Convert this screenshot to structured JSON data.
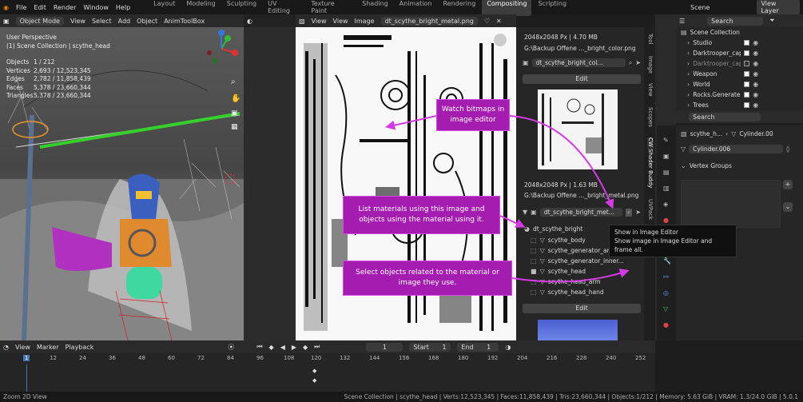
{
  "topbar": {
    "menus": [
      "File",
      "Edit",
      "Render",
      "Window",
      "Help"
    ],
    "workspaces": [
      "Layout",
      "Modeling",
      "Sculpting",
      "UV Editing",
      "Texture Paint",
      "Shading",
      "Animation",
      "Rendering",
      "Compositing",
      "Scripting"
    ],
    "active": "Compositing",
    "scene": "Scene",
    "view_layer": "View Layer"
  },
  "viewport": {
    "mode": "Object Mode",
    "menu": [
      "View",
      "Select",
      "Add",
      "Object",
      "AnimToolBox"
    ],
    "perspective": "User Perspective",
    "collection": "(1) Scene Collection | scythe_head",
    "stats": [
      {
        "k": "Objects",
        "v": "1 / 212"
      },
      {
        "k": "Vertices",
        "v": "2,693 / 12,523,345"
      },
      {
        "k": "Edges",
        "v": "2,782 / 11,858,439"
      },
      {
        "k": "Faces",
        "v": "5,378 / 23,660,344"
      },
      {
        "k": "Triangles",
        "v": "5,378 / 23,660,344"
      }
    ]
  },
  "image_editor": {
    "menu": [
      "View",
      "View",
      "Image"
    ],
    "filename": "dt_scythe_bright_metal.png"
  },
  "sidebar": {
    "img1": {
      "size": "2048x2048 Px | 4.70 MB",
      "path": "G:\\Backup Offene ..._bright_color.png",
      "name": "dt_scythe_bright_col...",
      "edit": "Edit"
    },
    "img2": {
      "size": "2048x2048 Px | 1.63 MB",
      "path": "G:\\Backup Offene ..._bright_metal.png",
      "name": "dt_scythe_bright_met...",
      "edit": "Edit"
    },
    "material": "dt_scythe_bright",
    "objects": [
      "scythe_body",
      "scythe_generator_arm",
      "scythe_generator_inner...",
      "scythe_head",
      "scythe_head_arm",
      "scythe_head_hand"
    ]
  },
  "tabs": [
    "Tool",
    "Image",
    "View",
    "Scopes",
    "CW Shader Buddy",
    "UVPack"
  ],
  "callouts": {
    "c1": "Watch bitmaps in image editor",
    "c2": "List materials using this image and objects using the material using it.",
    "c3": "Select objects related to the material or image they use."
  },
  "tooltip": {
    "line1": "Show in Image Editor",
    "line2": "Show image in Image Editor and frame all."
  },
  "outliner": {
    "search": "Search",
    "title": "Scene Collection",
    "items": [
      "Studio",
      "Darktrooper_cap",
      "Darktrooper_cap",
      "Weapon",
      "World",
      "Rocks.Generate",
      "Trees"
    ]
  },
  "properties": {
    "search": "Search",
    "breadcrumb1": "scythe_h...",
    "breadcrumb2": "Cylinder.00",
    "object": "Cylinder.006",
    "section": "Vertex Groups"
  },
  "timeline": {
    "menu": [
      "View",
      "Marker",
      "Playback"
    ],
    "current": "1",
    "start_label": "Start",
    "start": "1",
    "end_label": "End",
    "end": "1",
    "frames": [
      "1",
      "12",
      "24",
      "36",
      "48",
      "60",
      "72",
      "84",
      "96",
      "108",
      "120",
      "132",
      "144",
      "156",
      "168",
      "180",
      "192",
      "204",
      "216",
      "228",
      "240",
      "252"
    ]
  },
  "status": {
    "left": "Zoom 2D View",
    "right": "Scene Collection | scythe_head | Verts:12,523,345 | Faces:11,858,439 | Tris:23,660,344 | Objects:1/212 | Memory: 5.63 GiB | VRAM: 1.3/24.0 GiB | 5.0.1"
  }
}
